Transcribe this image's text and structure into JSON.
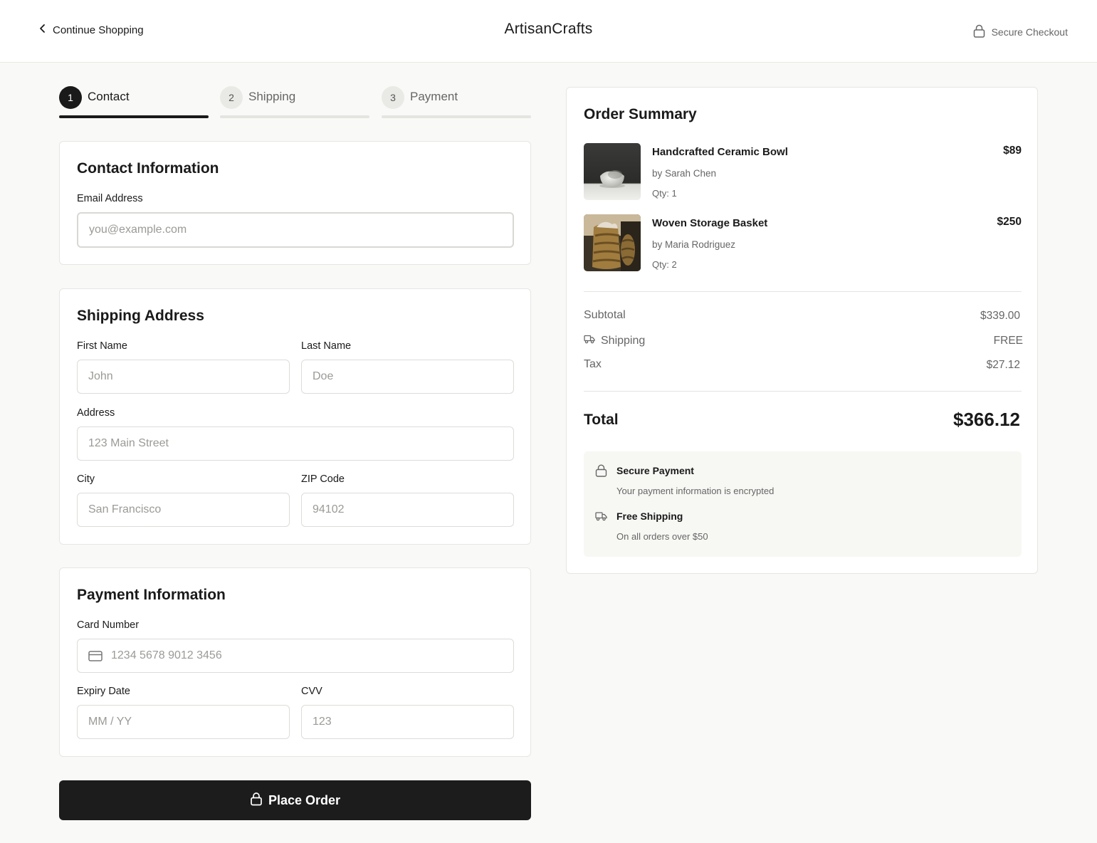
{
  "header": {
    "back_label": "Continue Shopping",
    "brand": "ArtisanCrafts",
    "secure_label": "Secure Checkout"
  },
  "steps": [
    {
      "number": "1",
      "label": "Contact",
      "active": true
    },
    {
      "number": "2",
      "label": "Shipping",
      "active": false
    },
    {
      "number": "3",
      "label": "Payment",
      "active": false
    }
  ],
  "contact": {
    "title": "Contact Information",
    "email_label": "Email Address",
    "email_placeholder": "you@example.com",
    "email_value": ""
  },
  "shipping": {
    "title": "Shipping Address",
    "first_name_label": "First Name",
    "first_name_placeholder": "John",
    "last_name_label": "Last Name",
    "last_name_placeholder": "Doe",
    "address_label": "Address",
    "address_placeholder": "123 Main Street",
    "city_label": "City",
    "city_placeholder": "San Francisco",
    "zip_label": "ZIP Code",
    "zip_placeholder": "94102"
  },
  "payment": {
    "title": "Payment Information",
    "card_label": "Card Number",
    "card_placeholder": "1234 5678 9012 3456",
    "expiry_label": "Expiry Date",
    "expiry_placeholder": "MM / YY",
    "cvv_label": "CVV",
    "cvv_placeholder": "123"
  },
  "place_order_label": "Place Order",
  "summary": {
    "title": "Order Summary",
    "items": [
      {
        "name": "Handcrafted Ceramic Bowl",
        "artist": "by Sarah Chen",
        "qty": "Qty: 1",
        "price": "$89",
        "image": "ceramic-bowl-photo"
      },
      {
        "name": "Woven Storage Basket",
        "artist": "by Maria Rodriguez",
        "qty": "Qty: 2",
        "price": "$250",
        "image": "woven-basket-photo"
      }
    ],
    "subtotal_label": "Subtotal",
    "subtotal_value": "$339.00",
    "shipping_label": "Shipping",
    "shipping_value": "FREE",
    "tax_label": "Tax",
    "tax_value": "$27.12",
    "total_label": "Total",
    "total_value": "$366.12",
    "info": [
      {
        "title": "Secure Payment",
        "subtitle": "Your payment information is encrypted",
        "icon": "lock-icon"
      },
      {
        "title": "Free Shipping",
        "subtitle": "On all orders over $50",
        "icon": "truck-icon"
      }
    ]
  },
  "colors": {
    "primary": "#1a1a1a",
    "background": "#f9f9f7",
    "muted_text": "#666666",
    "border": "#e6e6e2"
  }
}
